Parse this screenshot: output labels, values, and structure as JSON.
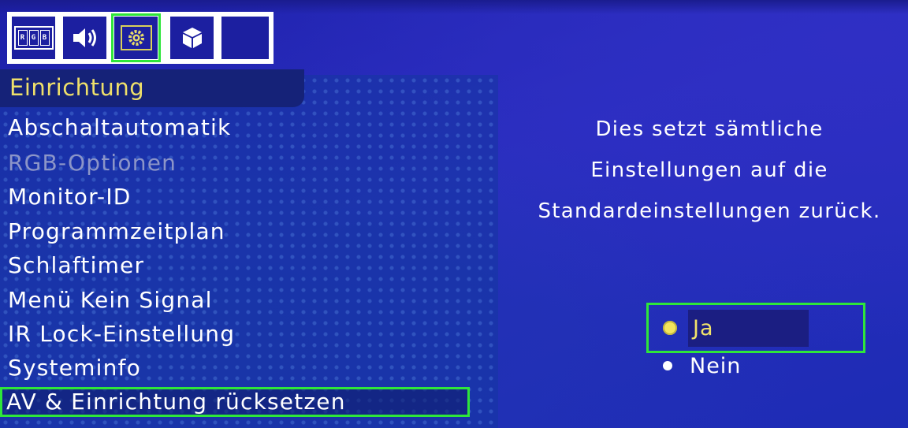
{
  "icon_bar": {
    "tabs": [
      {
        "name": "rgb-icon",
        "glyphs": [
          "R",
          "G",
          "B"
        ]
      },
      {
        "name": "speaker-icon"
      },
      {
        "name": "settings-icon",
        "selected": true
      },
      {
        "name": "cube-icon"
      },
      {
        "name": "empty-tab"
      }
    ]
  },
  "menu": {
    "title": "Einrichtung",
    "items": [
      {
        "label": "Abschaltautomatik",
        "state": "enabled"
      },
      {
        "label": "RGB-Optionen",
        "state": "disabled"
      },
      {
        "label": "Monitor-ID",
        "state": "enabled"
      },
      {
        "label": "Programmzeitplan",
        "state": "enabled"
      },
      {
        "label": "Schlaftimer",
        "state": "enabled"
      },
      {
        "label": "Menü Kein Signal",
        "state": "enabled"
      },
      {
        "label": "IR Lock-Einstellung",
        "state": "enabled"
      },
      {
        "label": "Systeminfo",
        "state": "enabled"
      },
      {
        "label": "AV & Einrichtung rücksetzen",
        "state": "selected"
      }
    ]
  },
  "description": {
    "lines": [
      "Dies setzt sämtliche",
      "Einstellungen auf die",
      "Standardeinstellungen zurück."
    ]
  },
  "options": [
    {
      "label": "Ja",
      "selected": true
    },
    {
      "label": "Nein",
      "selected": false
    }
  ],
  "colors": {
    "highlight": "#2ee63a",
    "title_text": "#efe06a",
    "selected_option": "#f2e46a",
    "disabled_text": "#8c95c8",
    "background": "#2a2ec0"
  }
}
